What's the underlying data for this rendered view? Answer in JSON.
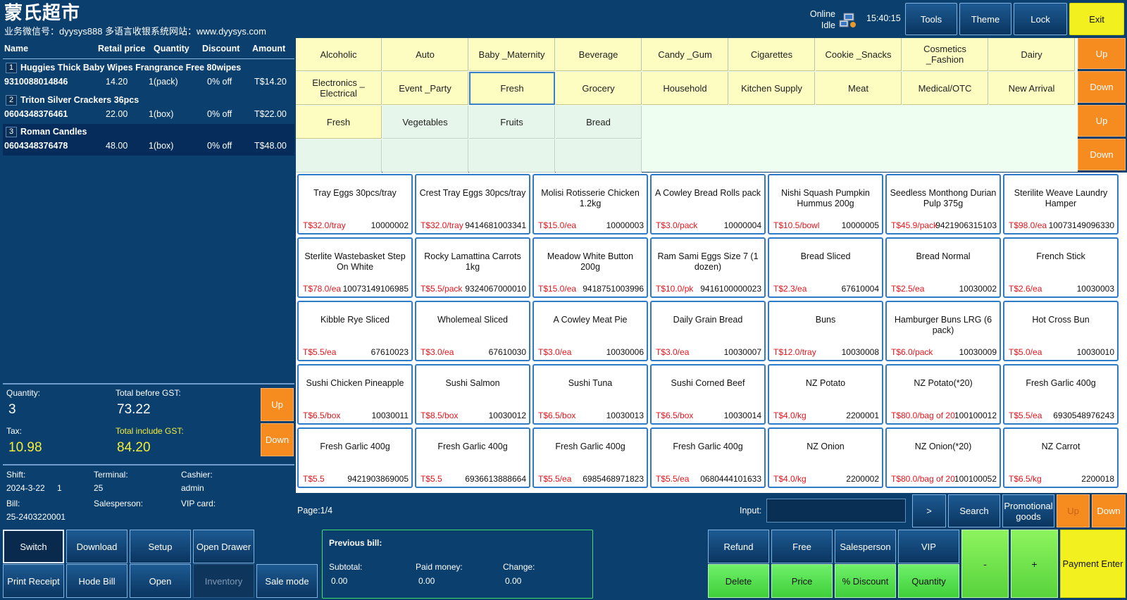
{
  "app": {
    "title": "蒙氏超市",
    "subtitle": "业务微信号：dyysys888 多语言收银系统网站：www.dyysys.com",
    "status_online": "Online",
    "status_idle": "Idle",
    "clock": "15:40:15"
  },
  "top_buttons": {
    "tools": "Tools",
    "theme": "Theme",
    "lock": "Lock",
    "exit": "Exit"
  },
  "cart": {
    "headers": {
      "name": "Name",
      "price": "Retail price",
      "qty": "Quantity",
      "discount": "Discount",
      "amount": "Amount"
    },
    "rows": [
      {
        "num": "1",
        "name": "Huggies Thick Baby Wipes Frangrance Free 80wipes",
        "code": "9310088014846",
        "price": "14.20",
        "qty": "1(pack)",
        "discount": "0% off",
        "amount": "T$14.20"
      },
      {
        "num": "2",
        "name": "Triton Silver Crackers 36pcs",
        "code": "0604348376461",
        "price": "22.00",
        "qty": "1(box)",
        "discount": "0% off",
        "amount": "T$22.00"
      },
      {
        "num": "3",
        "name": "Roman Candles",
        "code": "0604348376478",
        "price": "48.00",
        "qty": "1(box)",
        "discount": "0% off",
        "amount": "T$48.00"
      }
    ]
  },
  "summary": {
    "quantity_label": "Quantity:",
    "quantity": "3",
    "before_label": "Total before GST:",
    "before": "73.22",
    "tax_label": "Tax:",
    "tax": "10.98",
    "incl_label": "Total include GST:",
    "incl": "84.20",
    "up": "Up",
    "down": "Down"
  },
  "info": {
    "shift_label": "Shift:",
    "shift": "2024-3-22",
    "shift_no": "1",
    "terminal_label": "Terminal:",
    "terminal": "25",
    "cashier_label": "Cashier:",
    "cashier": "admin",
    "bill_label": "Bill:",
    "bill": "25-2403220001",
    "salesperson_label": "Salesperson:",
    "vip_label": "VIP card:"
  },
  "categories": {
    "row1": [
      "Alcoholic",
      "Auto",
      "Baby _Maternity",
      "Beverage",
      "Candy _Gum",
      "Cigarettes",
      "Cookie _Snacks",
      "Cosmetics _Fashion",
      "Dairy"
    ],
    "row2": [
      "Electronics _ Electrical",
      "Event _Party",
      "Fresh",
      "Grocery",
      "Household",
      "Kitchen Supply",
      "Meat",
      "Medical/OTC",
      "New Arrival"
    ],
    "sub": [
      "Fresh",
      "Vegetables",
      "Fruits",
      "Bread"
    ],
    "up": "Up",
    "down": "Down"
  },
  "products": [
    {
      "name": "Tray Eggs 30pcs/tray",
      "price": "T$32.0/tray",
      "code": "10000002"
    },
    {
      "name": "Crest Tray Eggs 30pcs/tray",
      "price": "T$32.0/tray",
      "code": "9414681003341"
    },
    {
      "name": "Molisi Rotisserie Chicken 1.2kg",
      "price": "T$15.0/ea",
      "code": "10000003"
    },
    {
      "name": "A Cowley Bread Rolls pack",
      "price": "T$3.0/pack",
      "code": "10000004"
    },
    {
      "name": "Nishi Squash Pumpkin Hummus 200g",
      "price": "T$10.5/bowl",
      "code": "10000005"
    },
    {
      "name": "Seedless Monthong Durian Pulp 375g",
      "price": "T$45.9/pack",
      "code": "9421906315103"
    },
    {
      "name": "Sterilite Weave Laundry Hamper",
      "price": "T$98.0/ea",
      "code": "10073149096330"
    },
    {
      "name": "Sterlite Wastebasket Step On White",
      "price": "T$78.0/ea",
      "code": "10073149106985"
    },
    {
      "name": "Rocky Lamattina Carrots 1kg",
      "price": "T$5.5/pack",
      "code": "9324067000010"
    },
    {
      "name": "Meadow White Button 200g",
      "price": "T$15.0/ea",
      "code": "9418751003996"
    },
    {
      "name": "Ram Sami Eggs Size 7 (1 dozen)",
      "price": "T$10.0/pk",
      "code": "9416100000023"
    },
    {
      "name": "Bread Sliced",
      "price": "T$2.3/ea",
      "code": "67610004"
    },
    {
      "name": "Bread Normal",
      "price": "T$2.5/ea",
      "code": "10030002"
    },
    {
      "name": "French Stick",
      "price": "T$2.6/ea",
      "code": "10030003"
    },
    {
      "name": "Kibble Rye Sliced",
      "price": "T$5.5/ea",
      "code": "67610023"
    },
    {
      "name": "Wholemeal Sliced",
      "price": "T$3.0/ea",
      "code": "67610030"
    },
    {
      "name": "A Cowley Meat Pie",
      "price": "T$3.0/ea",
      "code": "10030006"
    },
    {
      "name": "Daily Grain Bread",
      "price": "T$3.0/ea",
      "code": "10030007"
    },
    {
      "name": "Buns",
      "price": "T$12.0/tray",
      "code": "10030008"
    },
    {
      "name": "Hamburger Buns LRG (6 pack)",
      "price": "T$6.0/pack",
      "code": "10030009"
    },
    {
      "name": "Hot Cross Bun",
      "price": "T$5.0/ea",
      "code": "10030010"
    },
    {
      "name": "Sushi Chicken Pineapple",
      "price": "T$6.5/box",
      "code": "10030011"
    },
    {
      "name": "Sushi Salmon",
      "price": "T$8.5/box",
      "code": "10030012"
    },
    {
      "name": "Sushi Tuna",
      "price": "T$6.5/box",
      "code": "10030013"
    },
    {
      "name": "Sushi Corned Beef",
      "price": "T$6.5/box",
      "code": "10030014"
    },
    {
      "name": "NZ Potato",
      "price": "T$4.0/kg",
      "code": "2200001"
    },
    {
      "name": "NZ Potato(*20)",
      "price": "T$80.0/bag of 20",
      "code": "100100012"
    },
    {
      "name": "Fresh Garlic 400g",
      "price": "T$5.5/ea",
      "code": "6930548976243"
    },
    {
      "name": "Fresh Garlic 400g",
      "price": "T$5.5",
      "code": "9421903869005"
    },
    {
      "name": "Fresh Garlic 400g",
      "price": "T$5.5",
      "code": "6936613888664"
    },
    {
      "name": "Fresh Garlic 400g",
      "price": "T$5.5/ea",
      "code": "6985468971823"
    },
    {
      "name": "Fresh Garlic 400g",
      "price": "T$5.5/ea",
      "code": "0680444101633"
    },
    {
      "name": "NZ Onion",
      "price": "T$4.0/kg",
      "code": "2200002"
    },
    {
      "name": "NZ Onion(*20)",
      "price": "T$80.0/bag of 20",
      "code": "100100052"
    },
    {
      "name": "NZ Carrot",
      "price": "T$6.5/kg",
      "code": "2200018"
    }
  ],
  "pager": {
    "page": "Page:1/4",
    "input_label": "Input:",
    "next": ">",
    "search": "Search",
    "promo": "Promotional goods",
    "up": "Up",
    "down": "Down"
  },
  "bottom": {
    "switch": "Switch",
    "download": "Download",
    "setup": "Setup",
    "open_drawer": "Open Drawer",
    "print": "Print Receipt",
    "hold": "Hode Bill",
    "open": "Open",
    "inventory": "Inventory",
    "sale_mode": "Sale mode"
  },
  "previous": {
    "title": "Previous bill:",
    "subtotal_label": "Subtotal:",
    "subtotal": "0.00",
    "paid_label": "Paid money:",
    "paid": "0.00",
    "change_label": "Change:",
    "change": "0.00"
  },
  "actions": {
    "refund": "Refund",
    "free": "Free",
    "salesperson": "Salesperson",
    "vip": "VIP",
    "delete": "Delete",
    "price": "Price",
    "discount": "% Discount",
    "quantity": "Quantity",
    "minus": "-",
    "plus": "+",
    "pay": "Payment Enter"
  },
  "colors": {
    "background": "#0b3f6e",
    "category_yellow": "#fdfcc1",
    "orange": "#f68b1f",
    "green": "#57d33c",
    "price_red": "#e8141b",
    "exit_yellow": "#f3f020"
  }
}
